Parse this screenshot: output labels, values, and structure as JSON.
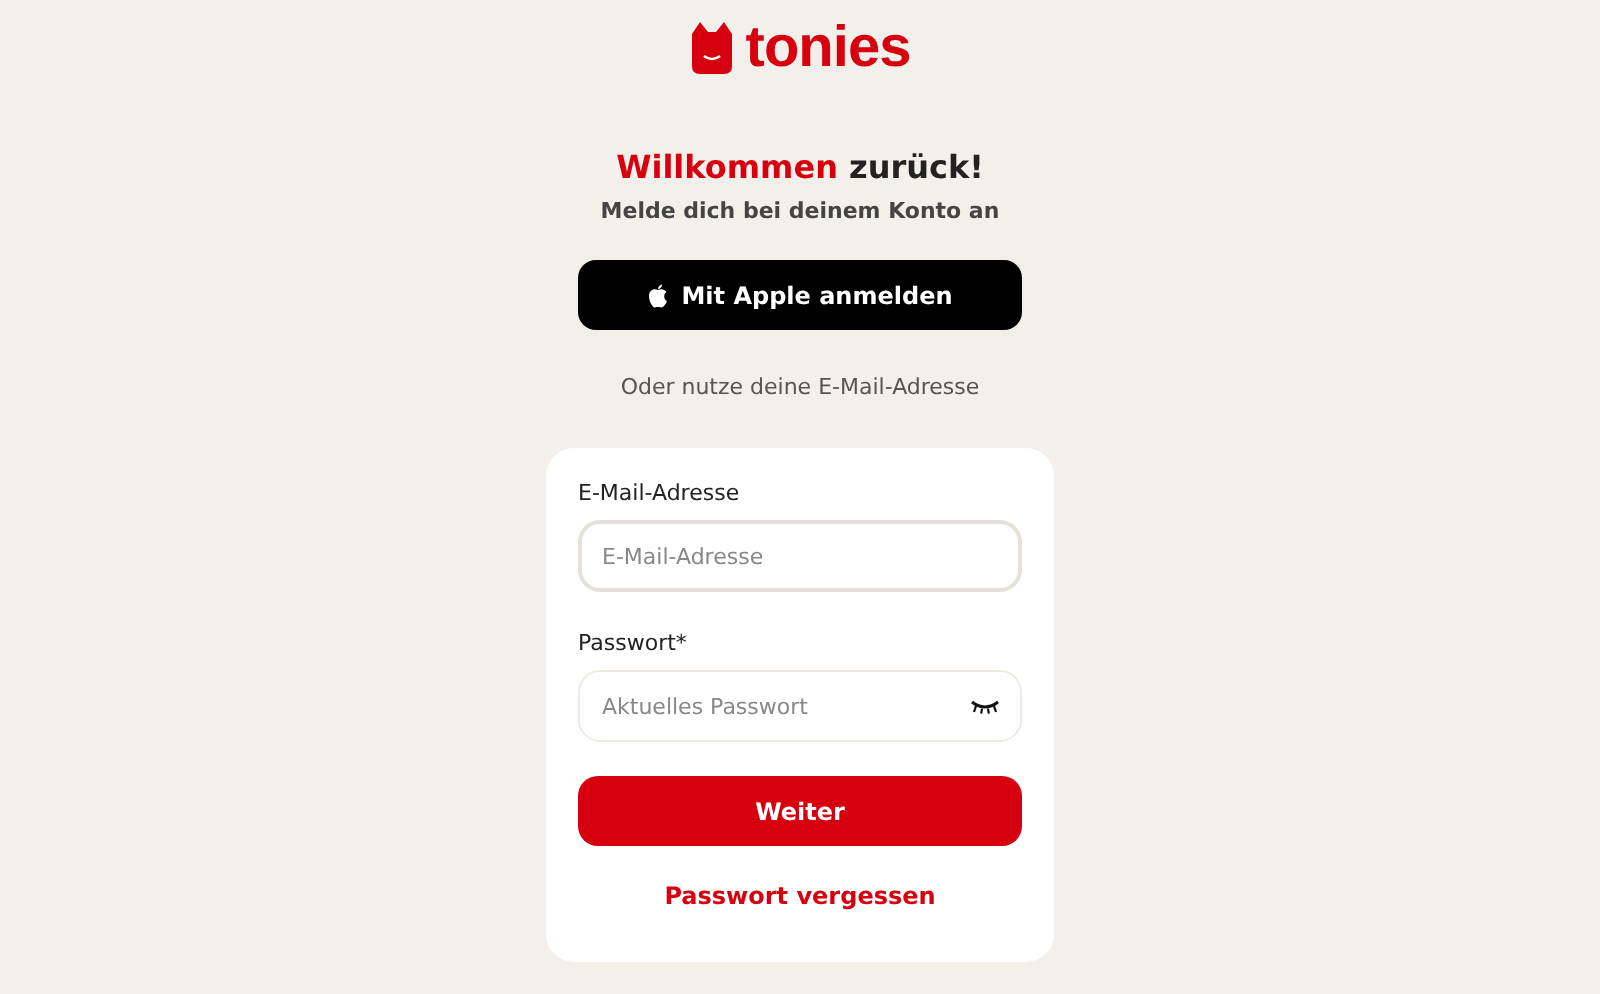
{
  "logo": {
    "text": "tonies"
  },
  "heading": {
    "highlight": "Willkommen",
    "rest": "zurück!"
  },
  "subtitle": "Melde dich bei deinem Konto an",
  "apple_button": {
    "label": "Mit Apple anmelden"
  },
  "divider_text": "Oder nutze deine E-Mail-Adresse",
  "form": {
    "fields": [
      {
        "label": "E-Mail-Adresse",
        "placeholder": "E-Mail-Adresse",
        "focused": true,
        "kind": "email"
      },
      {
        "label": "Passwort*",
        "placeholder": "Aktuelles Passwort",
        "focused": false,
        "kind": "password"
      }
    ],
    "submit": "Weiter",
    "forgot_link": "Passwort vergessen"
  }
}
